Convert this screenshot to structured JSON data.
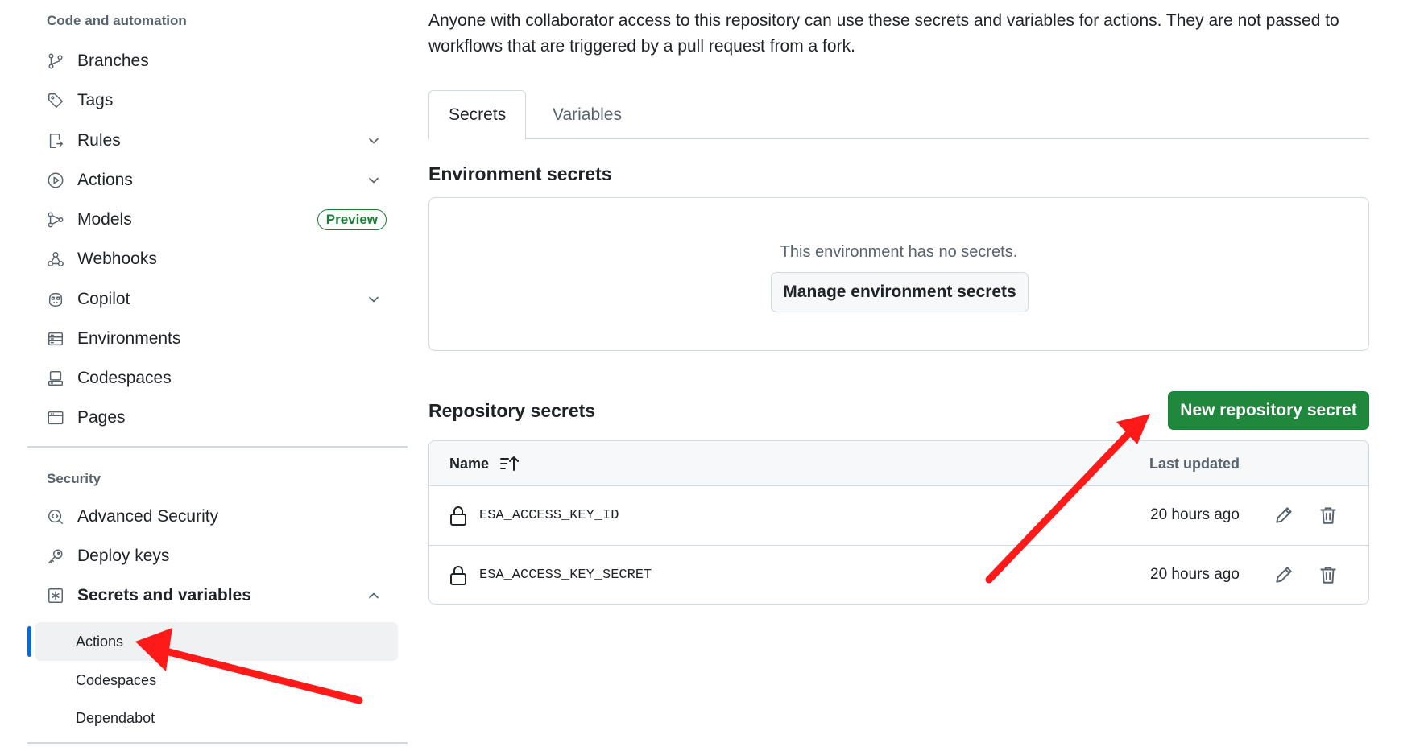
{
  "sidebar": {
    "code_section": "Code and automation",
    "code_items": [
      {
        "label": "Branches"
      },
      {
        "label": "Tags"
      },
      {
        "label": "Rules"
      },
      {
        "label": "Actions"
      },
      {
        "label": "Models",
        "badge": "Preview"
      },
      {
        "label": "Webhooks"
      },
      {
        "label": "Copilot"
      },
      {
        "label": "Environments"
      },
      {
        "label": "Codespaces"
      },
      {
        "label": "Pages"
      }
    ],
    "security_section": "Security",
    "security_items": [
      {
        "label": "Advanced Security"
      },
      {
        "label": "Deploy keys"
      },
      {
        "label": "Secrets and variables"
      }
    ],
    "secrets_sub_items": [
      {
        "label": "Actions",
        "active": true
      },
      {
        "label": "Codespaces"
      },
      {
        "label": "Dependabot"
      }
    ]
  },
  "main": {
    "intro": "Anyone with collaborator access to this repository can use these secrets and variables for actions. They are not passed to workflows that are triggered by a pull request from a fork.",
    "tabs": [
      {
        "label": "Secrets",
        "active": true
      },
      {
        "label": "Variables"
      }
    ],
    "environment_secrets": {
      "title": "Environment secrets",
      "empty_message": "This environment has no secrets.",
      "manage_button": "Manage environment secrets"
    },
    "repository_secrets": {
      "title": "Repository secrets",
      "new_button": "New repository secret",
      "columns": {
        "name": "Name",
        "updated": "Last updated"
      },
      "rows": [
        {
          "name": "ESA_ACCESS_KEY_ID",
          "updated": "20 hours ago"
        },
        {
          "name": "ESA_ACCESS_KEY_SECRET",
          "updated": "20 hours ago"
        }
      ]
    }
  },
  "colors": {
    "primary_button": "#1f883d",
    "active_indicator": "#0969da",
    "annotation_arrow": "#ff1a1a"
  }
}
